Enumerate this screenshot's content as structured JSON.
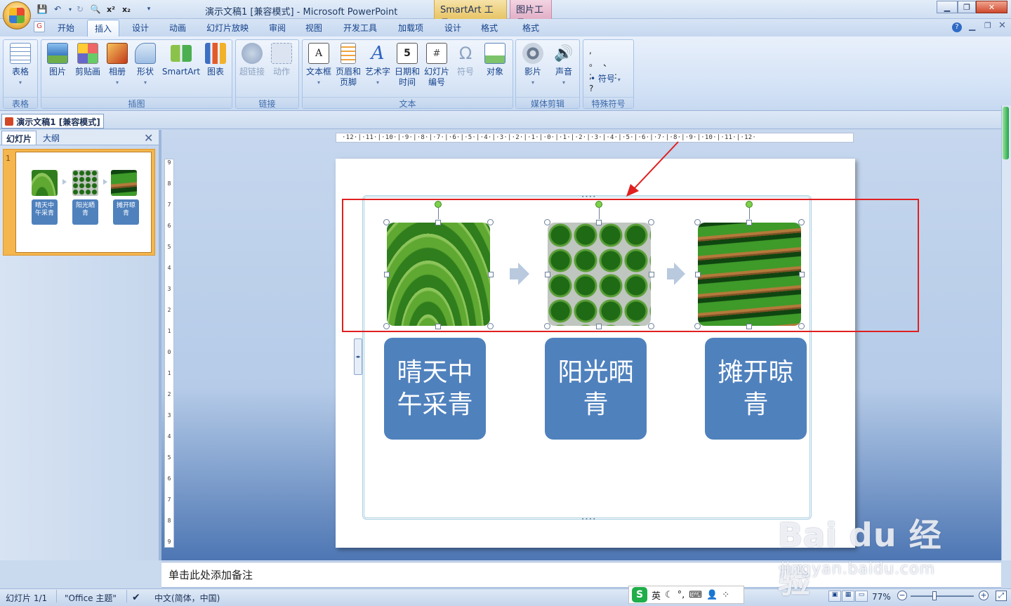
{
  "titlebar": {
    "window_title": "演示文稿1 [兼容模式] - Microsoft PowerPoint",
    "context_smartart": "SmartArt 工具",
    "context_picture": "图片工具"
  },
  "tabs": [
    "开始",
    "插入",
    "设计",
    "动画",
    "幻灯片放映",
    "审阅",
    "视图",
    "开发工具",
    "加载项",
    "设计",
    "格式",
    "格式"
  ],
  "ribbon": {
    "groups": {
      "tables": "表格",
      "illustrations": "插图",
      "links": "链接",
      "text": "文本",
      "media": "媒体剪辑",
      "symbols": "特殊符号"
    },
    "buttons": {
      "table": "表格",
      "picture": "图片",
      "clipart": "剪贴画",
      "album": "相册",
      "shapes": "形状",
      "smartart": "SmartArt",
      "chart": "图表",
      "hyperlink": "超链接",
      "action": "动作",
      "textbox": "文本框",
      "header_footer_1": "页眉和",
      "header_footer_2": "页脚",
      "wordart": "艺术字",
      "datetime_1": "日期和",
      "datetime_2": "时间",
      "slide_number_1": "幻灯片",
      "slide_number_2": "编号",
      "symbol": "符号",
      "object": "对象",
      "movie": "影片",
      "sound": "声音",
      "symbol_dd": "符号"
    }
  },
  "document_tab": "演示文稿1 [兼容模式]",
  "left_pane": {
    "tab_slides": "幻灯片",
    "tab_outline": "大纲",
    "slide_number": "1"
  },
  "ruler": {
    "horizontal": "·12·|·11·|·10·|·9·|·8·|·7·|·6·|·5·|·4·|·3·|·2·|·1·|·0·|·1·|·2·|·3·|·4·|·5·|·6·|·7·|·8·|·9·|·10·|·11·|·12·",
    "vertical": [
      "9",
      "8",
      "7",
      "6",
      "5",
      "4",
      "3",
      "2",
      "1",
      "0",
      "1",
      "2",
      "3",
      "4",
      "5",
      "6",
      "7",
      "8",
      "9"
    ]
  },
  "slide": {
    "steps": [
      {
        "line1": "晴天中",
        "line2": "午采青"
      },
      {
        "line1": "阳光晒",
        "line2": "青"
      },
      {
        "line1": "摊开晾",
        "line2": "青"
      }
    ]
  },
  "notes_placeholder": "单击此处添加备注",
  "status": {
    "slide_info": "幻灯片 1/1",
    "theme": "\"Office 主题\"",
    "language": "中文(简体，中国)",
    "zoom": "77%",
    "ime_mode": "英"
  },
  "watermark": {
    "main": "Bai du 经验",
    "sub": "jingyan.baidu.com"
  },
  "colors": {
    "box_fill": "#4f81bd",
    "highlight": "#e02020",
    "ribbon": "#dbe7f7"
  }
}
